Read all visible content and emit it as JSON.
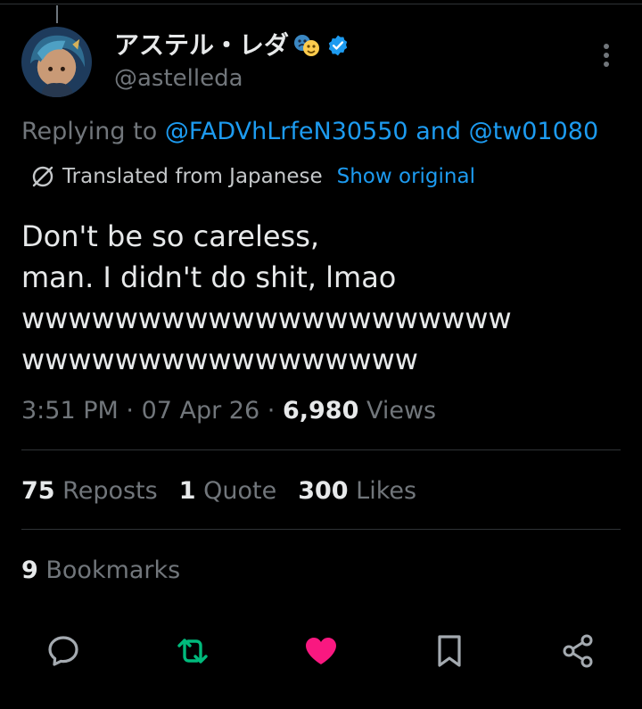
{
  "tweet": {
    "author": {
      "display_name": "アステル・レダ",
      "handle": "@astelleda",
      "name_emoji_icon": "performing-arts-icon",
      "verified_icon": "verified-badge-icon"
    },
    "reply": {
      "prefix": "Replying to",
      "mentions": [
        "@FADVhLrfeN30550",
        "@tw01080"
      ],
      "conjunction": "and"
    },
    "translation": {
      "icon": "translate-icon",
      "label": "Translated from Japanese",
      "show_original_label": "Show original"
    },
    "text_lines": [
      "Don't be so careless,",
      "man. I didn't do shit, lmao",
      "wwwwwwwwwwwwwwwwwwwww",
      "wwwwwwwwwwwwwwwww"
    ],
    "meta": {
      "time": "3:51 PM",
      "separator": "·",
      "date": "07 Apr 26",
      "views_count": "6,980",
      "views_label": "Views"
    },
    "stats": {
      "reposts_count": "75",
      "reposts_label": "Reposts",
      "quotes_count": "1",
      "quotes_label": "Quote",
      "likes_count": "300",
      "likes_label": "Likes",
      "bookmarks_count": "9",
      "bookmarks_label": "Bookmarks"
    }
  },
  "actions": [
    {
      "name": "reply-icon"
    },
    {
      "name": "repost-icon",
      "active": true,
      "color": "#00ba7c"
    },
    {
      "name": "like-icon",
      "active": true,
      "color": "#f91880"
    },
    {
      "name": "bookmark-icon"
    },
    {
      "name": "share-icon"
    }
  ],
  "colors": {
    "background": "#000000",
    "text_primary": "#e7e9ea",
    "text_secondary": "#71767b",
    "link": "#1d9bf0",
    "divider": "#2f3336",
    "repost_active": "#00ba7c",
    "like_active": "#f91880"
  }
}
